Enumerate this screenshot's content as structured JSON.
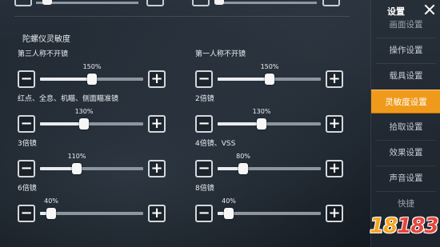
{
  "section": {
    "title": "陀螺仪灵敏度"
  },
  "groups": [
    {
      "label": "第三人称不开镜",
      "percent": "150%",
      "level": 0.5
    },
    {
      "label": "第一人称不开镜",
      "percent": "150%",
      "level": 0.5
    },
    {
      "label": "红点、全息、机瞄、侧面瞄准镜",
      "percent": "130%",
      "level": 0.43
    },
    {
      "label": "2倍镜",
      "percent": "130%",
      "level": 0.43
    },
    {
      "label": "3倍镜",
      "percent": "110%",
      "level": 0.36
    },
    {
      "label": "4倍镜、VSS",
      "percent": "80%",
      "level": 0.25
    },
    {
      "label": "6倍镜",
      "percent": "40%",
      "level": 0.11
    },
    {
      "label": "8倍镜",
      "percent": "40%",
      "level": 0.11
    }
  ],
  "buttons": {
    "minus": "−",
    "plus": "+"
  },
  "sidebar": {
    "title": "设置",
    "items": [
      {
        "label": "画面设置",
        "state": "partial"
      },
      {
        "label": "操作设置",
        "state": "normal"
      },
      {
        "label": "载具设置",
        "state": "normal"
      },
      {
        "label": "灵敏度设置",
        "state": "active"
      },
      {
        "label": "拾取设置",
        "state": "normal"
      },
      {
        "label": "效果设置",
        "state": "normal"
      },
      {
        "label": "声音设置",
        "state": "normal"
      },
      {
        "label": "快捷",
        "state": "partial"
      }
    ]
  },
  "watermark": {
    "part1": "18",
    "part2": "183"
  },
  "colors": {
    "accent": "#f09a1c",
    "track": "#8d969f",
    "knob": "#f7f7f7"
  }
}
